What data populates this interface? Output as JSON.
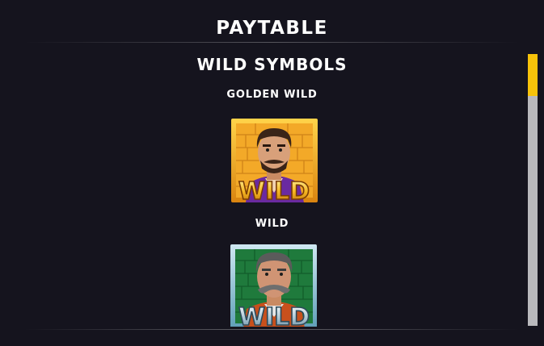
{
  "header": {
    "title": "PAYTABLE"
  },
  "section": {
    "title": "WILD SYMBOLS"
  },
  "symbols": [
    {
      "label": "GOLDEN WILD",
      "badge_text": "WILD",
      "icon": "golden-wild-symbol-icon"
    },
    {
      "label": "WILD",
      "badge_text": "WILD",
      "icon": "wild-symbol-icon"
    }
  ],
  "colors": {
    "background": "#15141e",
    "scroll_thumb": "#f7c30a",
    "scroll_track": "#b9b9bd",
    "golden_frame": "#f0a81c",
    "wild_frame": "#8fc4d8",
    "wild_bricks": "#1f7a3c"
  },
  "scrollbar": {
    "position": 0
  }
}
